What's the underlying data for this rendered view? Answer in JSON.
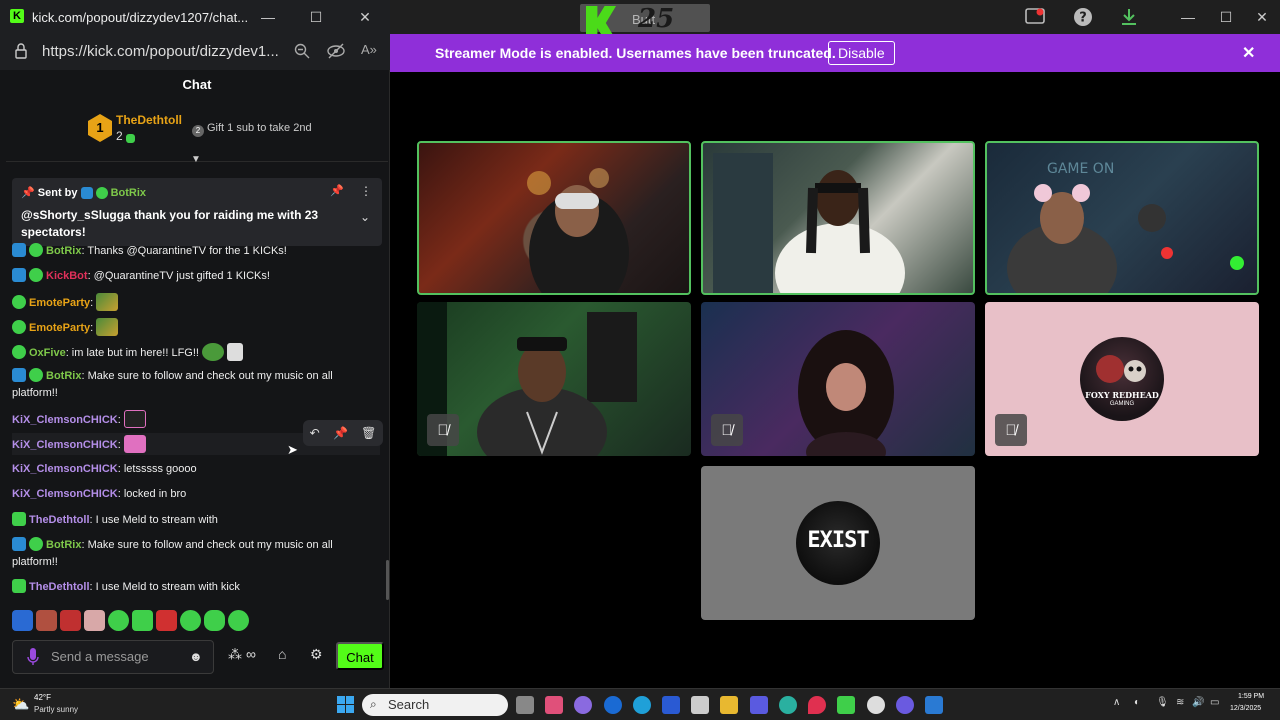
{
  "chat_window": {
    "title": "kick.com/popout/dizzydev1207/chat...",
    "url": "https://kick.com/popout/dizzydev1...",
    "header": "Chat",
    "leader": {
      "rank": "1",
      "name": "TheDethtoll",
      "count": "2",
      "gift_text": "Gift 1 sub to take 2nd"
    },
    "pinned": {
      "sent_by": "Sent by",
      "sender": "BotRix",
      "text": "@sShorty_sSlugga thank you for raiding me with 23 spectators!"
    },
    "messages": [
      {
        "user": "BotRix",
        "color": "#7ec84a",
        "text": ": Thanks @QuarantineTV for the 1 KICKs!"
      },
      {
        "user": "KickBot",
        "color": "#e0305a",
        "text": ": @QuarantineTV just gifted 1 KICKs!"
      },
      {
        "user": "EmoteParty",
        "color": "#e8a316",
        "text": ":"
      },
      {
        "user": "EmoteParty",
        "color": "#e8a316",
        "text": ":"
      },
      {
        "user": "OxFive",
        "color": "#7ec84a",
        "text": ": im late but im here!! LFG!!"
      },
      {
        "user": "BotRix",
        "color": "#7ec84a",
        "text": ": Make sure to follow and check out my music on all platform!!"
      },
      {
        "user": "KiX_ClemsonCHICK",
        "color": "#b48ee8",
        "text": ":"
      },
      {
        "user": "KiX_ClemsonCHICK",
        "color": "#b48ee8",
        "text": ":"
      },
      {
        "user": "KiX_ClemsonCHICK",
        "color": "#b48ee8",
        "text": ": letsssss goooo"
      },
      {
        "user": "KiX_ClemsonCHICK",
        "color": "#b48ee8",
        "text": ": locked in bro"
      },
      {
        "user": "TheDethtoll",
        "color": "#b48ee8",
        "text": ": I use Meld to stream with"
      },
      {
        "user": "BotRix",
        "color": "#7ec84a",
        "text": ": Make sure to follow and check out my music on all platform!!"
      },
      {
        "user": "TheDethtoll",
        "color": "#b48ee8",
        "text": ": I use Meld to stream with kick"
      }
    ],
    "input_placeholder": "Send a message",
    "send_label": "Chat"
  },
  "main_window": {
    "title_fragment": "Butt",
    "banner_text": "Streamer Mode is enabled. Usernames have been truncated.",
    "banner_button": "Disable"
  },
  "tiles": [
    {
      "name": "participant-1",
      "speaking": true,
      "muted": false
    },
    {
      "name": "participant-2",
      "speaking": true,
      "muted": false
    },
    {
      "name": "participant-3",
      "speaking": true,
      "muted": false
    },
    {
      "name": "participant-4",
      "speaking": false,
      "muted": true
    },
    {
      "name": "participant-5",
      "speaking": false,
      "muted": true
    },
    {
      "name": "participant-6",
      "speaking": false,
      "muted": true,
      "avatar_text_1": "FOXY REDHEAD",
      "avatar_text_2": "GAMING"
    },
    {
      "name": "participant-7",
      "speaking": false,
      "muted": false,
      "avatar_text_1": "EXIST"
    }
  ],
  "taskbar": {
    "weather_temp": "42°F",
    "weather_desc": "Partly sunny",
    "search_placeholder": "Search",
    "time": "1:59 PM",
    "date": "12/3/2025"
  },
  "colors": {
    "kick_green": "#53fc18",
    "banner_purple": "#8f2fd9",
    "speaking_border": "#53c15f"
  }
}
